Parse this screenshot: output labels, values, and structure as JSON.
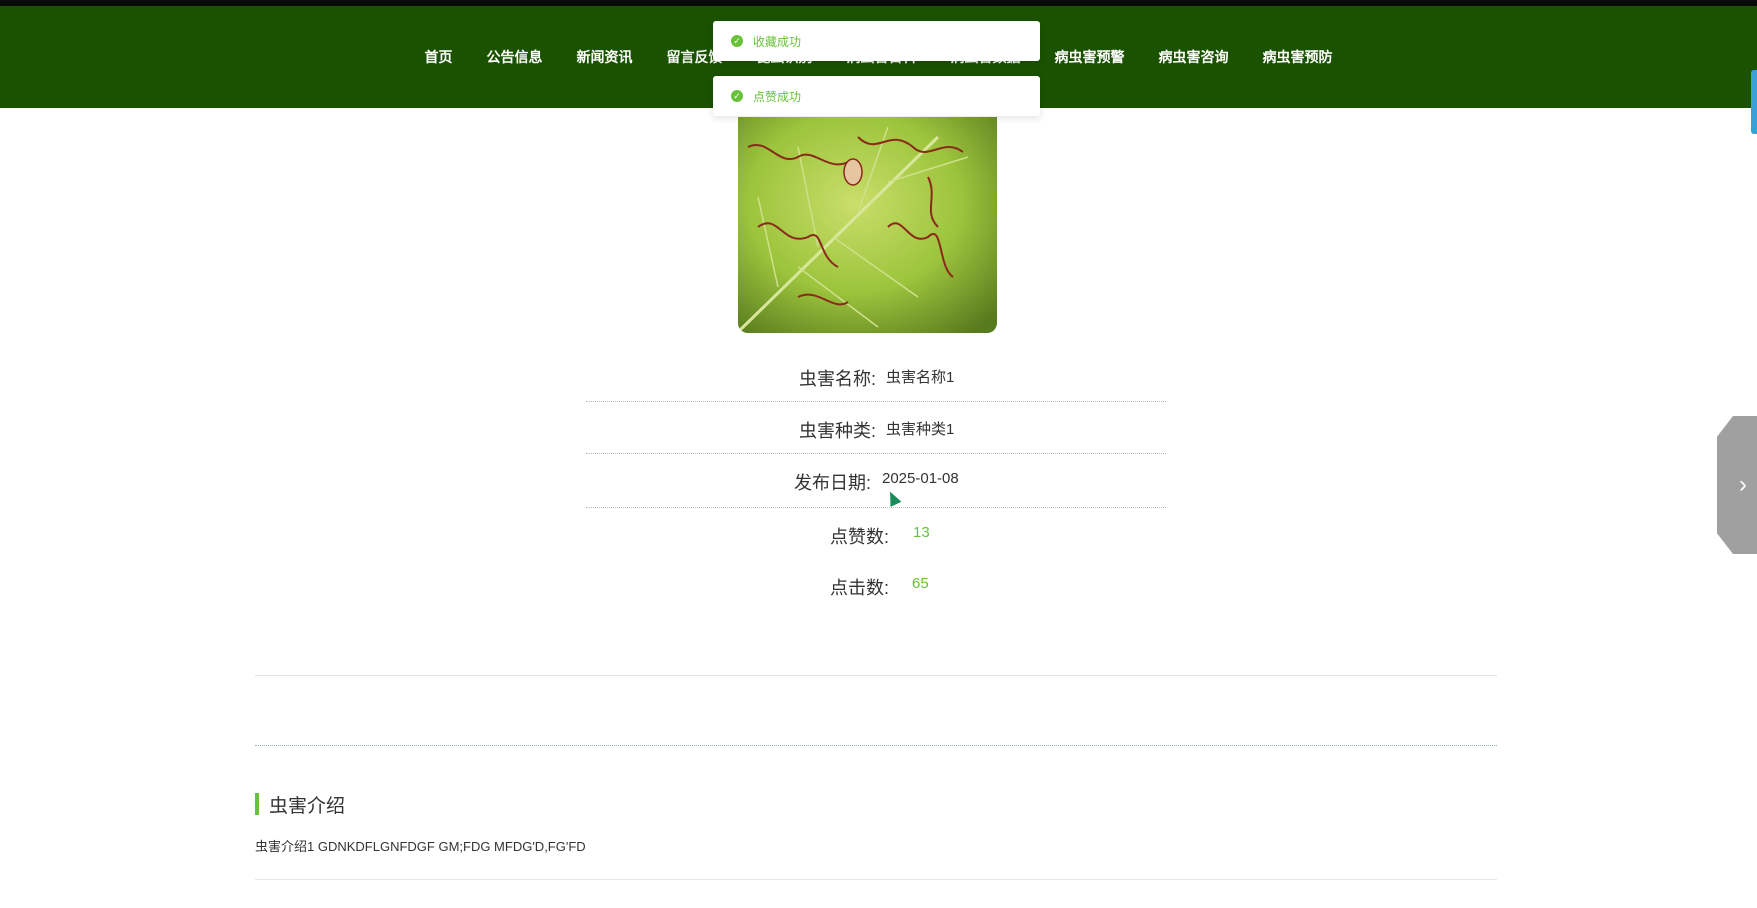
{
  "nav": {
    "items": [
      "首页",
      "公告信息",
      "新闻资讯",
      "留言反馈",
      "昆虫识别",
      "病虫害百科",
      "病虫害数据",
      "病虫害预警",
      "病虫害咨询",
      "病虫害预防"
    ]
  },
  "toasts": [
    {
      "text": "收藏成功"
    },
    {
      "text": "点赞成功"
    }
  ],
  "details": {
    "name_label": "虫害名称:",
    "name_value": "虫害名称1",
    "type_label": "虫害种类:",
    "type_value": "虫害种类1",
    "date_label": "发布日期:",
    "date_value": "2025-01-08",
    "likes_label": "点赞数:",
    "likes_value": "13",
    "clicks_label": "点击数:",
    "clicks_value": "65"
  },
  "section": {
    "title": "虫害介绍",
    "intro": "虫害介绍1 GDNKDFLGNFDGF GM;FDG MFDG'D,FG'FD"
  },
  "side_tab": {
    "icon": "chevron-right-icon",
    "glyph": "›"
  },
  "colors": {
    "nav_bg": "#1a5200",
    "accent": "#67c23a"
  }
}
